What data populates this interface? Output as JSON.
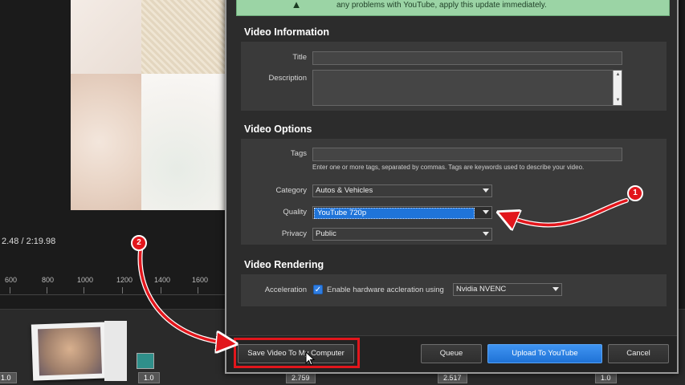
{
  "editor": {
    "time_display": "2.48 / 2:19.98",
    "ruler_ticks": [
      "600",
      "800",
      "1000",
      "1200",
      "1400",
      "1600"
    ],
    "thumb_values": [
      "1.0",
      "2.759",
      "2.517",
      "1.0"
    ],
    "first_thumb_value": "1.0"
  },
  "banner": {
    "text": "any problems with YouTube, apply this update immediately."
  },
  "video_information": {
    "title": "Video Information",
    "title_label": "Title",
    "title_value": "",
    "description_label": "Description",
    "description_value": ""
  },
  "video_options": {
    "title": "Video Options",
    "tags_label": "Tags",
    "tags_value": "",
    "tags_hint": "Enter one or more tags, separated by commas. Tags are keywords used to describe your video.",
    "category_label": "Category",
    "category_value": "Autos & Vehicles",
    "quality_label": "Quality",
    "quality_value": "YouTube 720p",
    "privacy_label": "Privacy",
    "privacy_value": "Public"
  },
  "video_rendering": {
    "title": "Video Rendering",
    "acceleration_label": "Acceleration",
    "checkbox_checked": true,
    "checkbox_label": "Enable hardware accleration using",
    "encoder_value": "Nvidia NVENC"
  },
  "footer": {
    "save_label": "Save Video To My Computer",
    "queue_label": "Queue",
    "upload_label": "Upload To YouTube",
    "cancel_label": "Cancel"
  },
  "callouts": {
    "badge_1": "1",
    "badge_2": "2"
  },
  "colors": {
    "accent_blue": "#1f72d6",
    "callout_red": "#e2161c",
    "banner_green": "#9bd4a5",
    "dialog_bg": "#2c2c2c"
  }
}
